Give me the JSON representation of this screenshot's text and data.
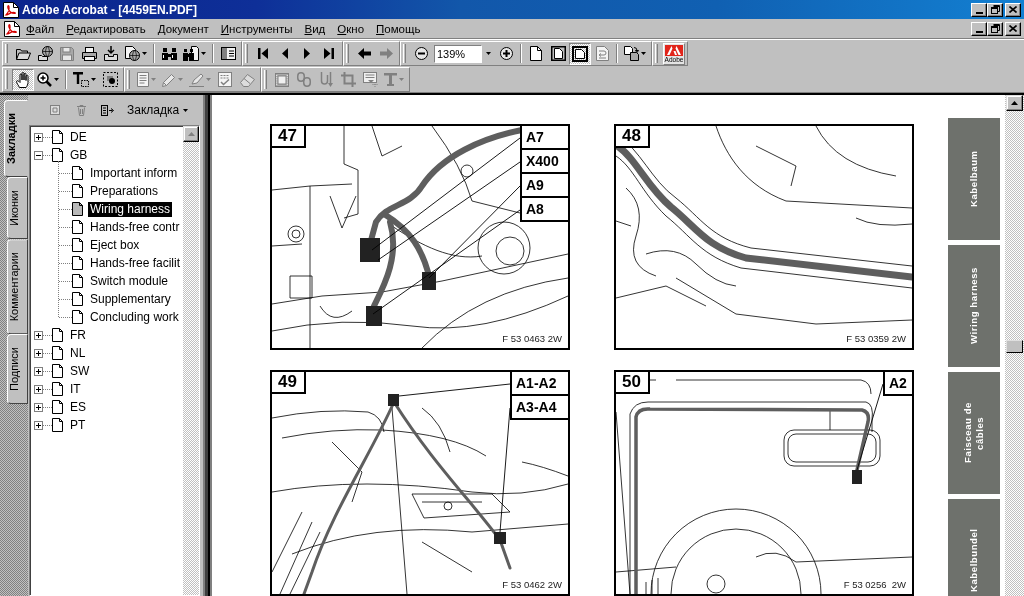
{
  "window": {
    "title": "Adobe Acrobat - [4459EN.PDF]"
  },
  "menu": [
    "Файл",
    "Редактировать",
    "Документ",
    "Инструменты",
    "Вид",
    "Окно",
    "Помощь"
  ],
  "toolbar_rows": [
    [
      {
        "sections": [
          [
            {
              "kind": "button",
              "disabled": false,
              "selected": false
            },
            {
              "kind": "button",
              "disabled": false,
              "selected": false
            },
            {
              "kind": "button",
              "disabled": true,
              "selected": false
            },
            {
              "kind": "button",
              "disabled": false,
              "selected": false
            },
            {
              "kind": "button",
              "disabled": false,
              "selected": false
            },
            {
              "kind": "split",
              "disabled": false,
              "selected": false
            }
          ],
          [
            {
              "kind": "button",
              "disabled": false,
              "selected": false
            },
            {
              "kind": "split",
              "disabled": false,
              "selected": false
            }
          ],
          [
            {
              "kind": "button",
              "disabled": false,
              "selected": false
            }
          ]
        ]
      },
      {
        "sections": [
          [
            {
              "kind": "button",
              "disabled": false,
              "selected": false
            },
            {
              "kind": "button",
              "disabled": false,
              "selected": false
            },
            {
              "kind": "button",
              "disabled": false,
              "selected": false
            },
            {
              "kind": "button",
              "disabled": false,
              "selected": false
            }
          ]
        ]
      },
      {
        "sections": [
          [
            {
              "kind": "button",
              "disabled": false,
              "selected": false
            },
            {
              "kind": "button",
              "disabled": true,
              "selected": false
            }
          ]
        ]
      },
      {
        "sections": [
          [
            {
              "kind": "button",
              "disabled": false,
              "selected": false
            },
            {
              "kind": "field",
              "value": "139%"
            },
            {
              "kind": "button",
              "disabled": false,
              "selected": false
            }
          ],
          [
            {
              "kind": "button",
              "disabled": false,
              "selected": false
            },
            {
              "kind": "button",
              "disabled": false,
              "selected": false
            },
            {
              "kind": "button",
              "disabled": false,
              "selected": true
            },
            {
              "kind": "button",
              "disabled": true,
              "selected": false
            }
          ],
          [
            {
              "kind": "split",
              "disabled": false,
              "selected": false
            }
          ]
        ]
      },
      {
        "sections": [
          [
            {
              "kind": "logo",
              "label": "Adobe"
            }
          ]
        ]
      }
    ],
    [
      {
        "sections": [
          [
            {
              "kind": "button",
              "disabled": false,
              "selected": true
            },
            {
              "kind": "split",
              "disabled": false,
              "selected": false
            }
          ],
          [
            {
              "kind": "split",
              "disabled": false,
              "selected": false
            },
            {
              "kind": "button",
              "disabled": false,
              "selected": false
            }
          ]
        ]
      },
      {
        "sections": [
          [
            {
              "kind": "split",
              "disabled": true,
              "selected": false
            },
            {
              "kind": "split",
              "disabled": true,
              "selected": false
            },
            {
              "kind": "split",
              "disabled": true,
              "selected": false
            },
            {
              "kind": "button",
              "disabled": true,
              "selected": false
            },
            {
              "kind": "button",
              "disabled": true,
              "selected": false
            }
          ]
        ]
      },
      {
        "sections": [
          [
            {
              "kind": "button",
              "disabled": true,
              "selected": false
            },
            {
              "kind": "button",
              "disabled": true,
              "selected": false
            },
            {
              "kind": "button",
              "disabled": true,
              "selected": false
            },
            {
              "kind": "button",
              "disabled": true,
              "selected": false
            },
            {
              "kind": "button",
              "disabled": true,
              "selected": false
            },
            {
              "kind": "split",
              "disabled": true,
              "selected": false
            }
          ]
        ]
      }
    ]
  ],
  "navigation_panel": {
    "tabs": [
      {
        "label": "Закладки",
        "selected": true
      },
      {
        "label": "Иконки",
        "selected": false
      },
      {
        "label": "Комментарии",
        "selected": false
      },
      {
        "label": "Подписи",
        "selected": false
      }
    ],
    "tools": [
      {
        "disabled": true
      },
      {
        "disabled": true
      },
      {
        "disabled": false
      }
    ],
    "options_menu": "Закладка",
    "bookmarks": [
      {
        "label": "DE",
        "expanded": false,
        "selected": false
      },
      {
        "label": "GB",
        "expanded": true,
        "selected": false,
        "children": [
          {
            "label": "Important inform",
            "selected": false
          },
          {
            "label": "Preparations",
            "selected": false
          },
          {
            "label": "Wiring harness",
            "selected": true
          },
          {
            "label": "Hands-free contr",
            "selected": false
          },
          {
            "label": "Eject box",
            "selected": false
          },
          {
            "label": "Hands-free facilit",
            "selected": false
          },
          {
            "label": "Switch module",
            "selected": false
          },
          {
            "label": "Supplementary",
            "selected": false
          },
          {
            "label": "Concluding work",
            "selected": false
          }
        ]
      },
      {
        "label": "FR",
        "expanded": false,
        "selected": false
      },
      {
        "label": "NL",
        "expanded": false,
        "selected": false
      },
      {
        "label": "SW",
        "expanded": false,
        "selected": false
      },
      {
        "label": "IT",
        "expanded": false,
        "selected": false
      },
      {
        "label": "ES",
        "expanded": false,
        "selected": false
      },
      {
        "label": "PT",
        "expanded": false,
        "selected": false
      }
    ]
  },
  "document": {
    "figures": [
      {
        "number": "47",
        "callouts": [
          "A7",
          "X400",
          "A9",
          "A8"
        ],
        "code": "F 53 0463 2W"
      },
      {
        "number": "48",
        "code": "F 53 0359 2W"
      },
      {
        "number": "49",
        "callouts": [
          "A1-A2",
          "A3-A4"
        ],
        "code": "F 53 0462 2W"
      },
      {
        "number": "50",
        "callouts": [
          "A2"
        ],
        "code": "F 53 0256  2W"
      }
    ],
    "section_tabs": [
      "Kabelbaum",
      "Wiring harness",
      "Faisceau de câbles",
      "Kabelbundel"
    ]
  }
}
